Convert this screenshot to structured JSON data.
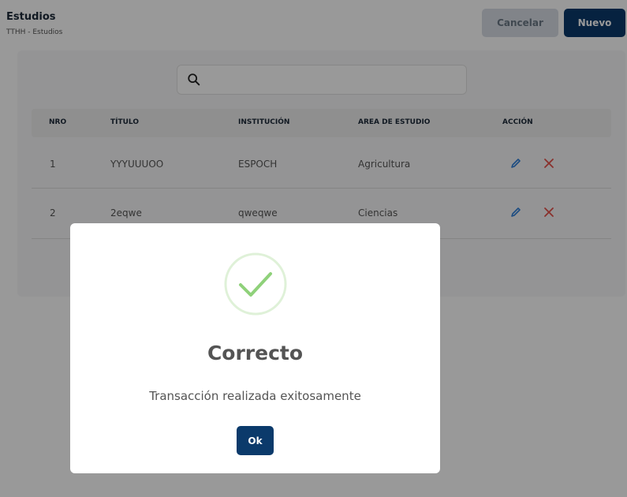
{
  "header": {
    "title": "Estudios",
    "breadcrumb": "TTHH  - Estudios",
    "cancel_label": "Cancelar",
    "new_label": "Nuevo"
  },
  "search": {
    "value": "",
    "placeholder": ""
  },
  "table": {
    "headers": [
      "NRO",
      "TÍTULO",
      "INSTITUCIÓN",
      "AREA DE ESTUDIO",
      "ACCIÓN"
    ],
    "rows": [
      [
        "1",
        "YYYUUUOO",
        "ESPOCH",
        "Agricultura"
      ],
      [
        "2",
        "2eqwe",
        "qweqwe",
        "Ciencias"
      ]
    ]
  },
  "icons": {
    "search": "search-icon",
    "edit": "pencil-icon",
    "delete": "close-icon",
    "success": "check-icon"
  },
  "colors": {
    "primary": "#0b3a6b",
    "cancel_bg": "#d7dde5",
    "edit": "#2f7fd9",
    "delete": "#e5534b",
    "success": "#8fd17a"
  },
  "modal": {
    "title": "Correcto",
    "message": "Transacción realizada exitosamente",
    "ok_label": "Ok"
  }
}
